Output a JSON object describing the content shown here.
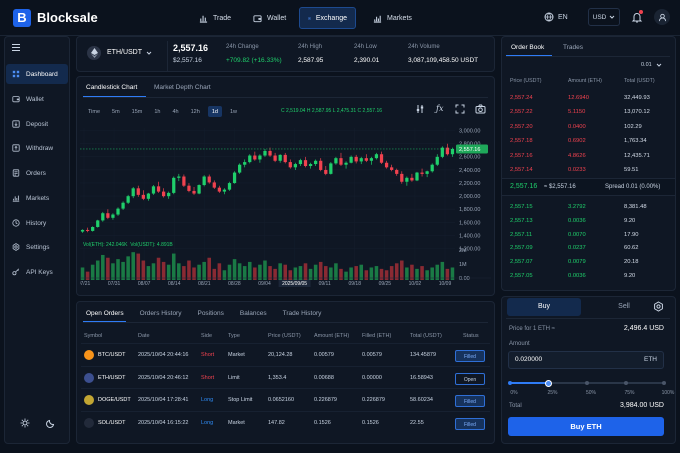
{
  "app": {
    "logo_letter": "B",
    "name": "Blocksale"
  },
  "nav": [
    {
      "label": "Trade",
      "icon": "chart-icon"
    },
    {
      "label": "Wallet",
      "icon": "wallet-icon"
    },
    {
      "label": "Exchange",
      "icon": "exchange-icon"
    },
    {
      "label": "Markets",
      "icon": "markets-icon"
    }
  ],
  "header_right": {
    "language": "EN",
    "currency": "USD"
  },
  "sidebar": {
    "items": [
      {
        "label": "Dashboard",
        "icon": "grid-icon"
      },
      {
        "label": "Wallet",
        "icon": "wallet-icon"
      },
      {
        "label": "Deposit",
        "icon": "deposit-icon"
      },
      {
        "label": "Withdraw",
        "icon": "withdraw-icon"
      },
      {
        "label": "Orders",
        "icon": "orders-icon"
      },
      {
        "label": "Markets",
        "icon": "markets-icon"
      },
      {
        "label": "History",
        "icon": "history-icon"
      },
      {
        "label": "Settings",
        "icon": "gear-icon"
      },
      {
        "label": "API Keys",
        "icon": "key-icon"
      }
    ]
  },
  "ticker": {
    "pair": "ETH/USDT",
    "price": "2,557.16",
    "price_usd": "$2,557.16",
    "change_label": "24h Change",
    "change": "+709.82 (+16.33%)",
    "high_label": "24h High",
    "high": "2,587.95",
    "low_label": "24h Low",
    "low": "2,390.01",
    "vol_label": "24h Volume",
    "volume": "3,087,109,458.50 USDT"
  },
  "chart": {
    "tabs": [
      "Candlestick Chart",
      "Market Depth Chart"
    ],
    "timeframes": [
      "Time",
      "5m",
      "15m",
      "1h",
      "4h",
      "12h",
      "1d",
      "1w"
    ],
    "active_tf": "1d",
    "ohlc": "C 2,519.04 H 2,587.95 L 2,475.31 C 2,557.16",
    "vol": "Vol(ETH): 242.046K",
    "vol2": "Vol(USDT): 4.891B",
    "price_tag": "2,557.16",
    "y_ticks": [
      "3,000.00",
      "2,800.00",
      "2,600.00",
      "2,400.00",
      "2,200.00",
      "2,000.00",
      "1,800.00",
      "1,600.00",
      "1,400.00",
      "1,200.00"
    ],
    "vol_ticks": [
      "2M",
      "1M",
      "0.00"
    ],
    "x_ticks": [
      "07/21",
      "07/31",
      "08/07",
      "08/14",
      "08/21",
      "08/28",
      "09/04",
      "2025/09/05",
      "09/11",
      "09/18",
      "09/25",
      "10/02",
      "10/09"
    ]
  },
  "chart_data": {
    "type": "candlestick",
    "candles": [
      [
        1420,
        1455,
        1400,
        1445
      ],
      [
        1445,
        1480,
        1410,
        1430
      ],
      [
        1430,
        1500,
        1420,
        1490
      ],
      [
        1490,
        1600,
        1480,
        1590
      ],
      [
        1590,
        1720,
        1570,
        1700
      ],
      [
        1700,
        1760,
        1610,
        1630
      ],
      [
        1630,
        1700,
        1600,
        1680
      ],
      [
        1680,
        1790,
        1660,
        1770
      ],
      [
        1770,
        1880,
        1750,
        1860
      ],
      [
        1860,
        1980,
        1840,
        1960
      ],
      [
        1960,
        2100,
        1930,
        2080
      ],
      [
        2080,
        2120,
        1950,
        1980
      ],
      [
        1980,
        2050,
        1900,
        1920
      ],
      [
        1920,
        2010,
        1890,
        2000
      ],
      [
        2000,
        2130,
        1980,
        2110
      ],
      [
        2110,
        2180,
        2010,
        2030
      ],
      [
        2030,
        2080,
        1940,
        1960
      ],
      [
        1960,
        2030,
        1920,
        2010
      ],
      [
        2010,
        2260,
        1990,
        2240
      ],
      [
        2240,
        2300,
        2190,
        2260
      ],
      [
        2260,
        2290,
        2100,
        2120
      ],
      [
        2120,
        2160,
        2020,
        2040
      ],
      [
        2040,
        2100,
        1980,
        2000
      ],
      [
        2000,
        2140,
        1990,
        2130
      ],
      [
        2130,
        2280,
        2110,
        2260
      ],
      [
        2260,
        2290,
        2150,
        2170
      ],
      [
        2170,
        2200,
        2070,
        2090
      ],
      [
        2090,
        2120,
        2010,
        2030
      ],
      [
        2030,
        2080,
        1990,
        2060
      ],
      [
        2060,
        2180,
        2040,
        2160
      ],
      [
        2160,
        2340,
        2150,
        2320
      ],
      [
        2320,
        2460,
        2300,
        2440
      ],
      [
        2440,
        2520,
        2400,
        2480
      ],
      [
        2480,
        2600,
        2460,
        2580
      ],
      [
        2580,
        2640,
        2500,
        2520
      ],
      [
        2520,
        2600,
        2470,
        2580
      ],
      [
        2580,
        2680,
        2560,
        2650
      ],
      [
        2650,
        2700,
        2560,
        2580
      ],
      [
        2580,
        2620,
        2480,
        2500
      ],
      [
        2500,
        2600,
        2470,
        2590
      ],
      [
        2590,
        2620,
        2460,
        2480
      ],
      [
        2480,
        2520,
        2380,
        2400
      ],
      [
        2400,
        2470,
        2360,
        2450
      ],
      [
        2450,
        2530,
        2420,
        2510
      ],
      [
        2510,
        2560,
        2400,
        2420
      ],
      [
        2420,
        2470,
        2380,
        2450
      ],
      [
        2450,
        2520,
        2420,
        2500
      ],
      [
        2500,
        2540,
        2340,
        2360
      ],
      [
        2360,
        2420,
        2280,
        2300
      ],
      [
        2300,
        2480,
        2290,
        2460
      ],
      [
        2460,
        2560,
        2440,
        2540
      ],
      [
        2540,
        2620,
        2420,
        2440
      ],
      [
        2440,
        2490,
        2380,
        2470
      ],
      [
        2470,
        2580,
        2460,
        2560
      ],
      [
        2560,
        2590,
        2460,
        2490
      ],
      [
        2490,
        2560,
        2450,
        2540
      ],
      [
        2540,
        2600,
        2480,
        2500
      ],
      [
        2500,
        2560,
        2440,
        2540
      ],
      [
        2540,
        2620,
        2520,
        2600
      ],
      [
        2600,
        2640,
        2450,
        2470
      ],
      [
        2470,
        2500,
        2380,
        2400
      ],
      [
        2400,
        2440,
        2340,
        2360
      ],
      [
        2360,
        2380,
        2270,
        2300
      ],
      [
        2300,
        2340,
        2150,
        2180
      ],
      [
        2180,
        2260,
        2120,
        2240
      ],
      [
        2240,
        2300,
        2180,
        2200
      ],
      [
        2200,
        2330,
        2190,
        2320
      ],
      [
        2320,
        2380,
        2260,
        2300
      ],
      [
        2300,
        2350,
        2250,
        2340
      ],
      [
        2340,
        2460,
        2320,
        2440
      ],
      [
        2440,
        2600,
        2420,
        2560
      ],
      [
        2560,
        2720,
        2540,
        2700
      ],
      [
        2700,
        2760,
        2580,
        2600
      ],
      [
        2600,
        2700,
        2560,
        2680
      ]
    ],
    "volume": [
      0.9,
      0.6,
      1.1,
      1.4,
      1.8,
      1.6,
      1.2,
      1.5,
      1.3,
      1.7,
      2.0,
      1.9,
      1.4,
      1.0,
      1.2,
      1.6,
      1.3,
      1.1,
      1.9,
      1.2,
      1.0,
      1.4,
      0.9,
      1.1,
      1.3,
      1.6,
      0.8,
      1.2,
      0.7,
      1.1,
      1.5,
      1.2,
      1.0,
      1.3,
      0.9,
      1.1,
      1.4,
      1.0,
      0.8,
      1.2,
      1.1,
      0.7,
      0.9,
      1.0,
      1.2,
      0.8,
      1.1,
      1.3,
      1.0,
      0.9,
      1.2,
      0.8,
      0.6,
      0.9,
      1.0,
      1.1,
      0.7,
      0.9,
      1.0,
      0.8,
      0.7,
      1.0,
      1.2,
      1.4,
      0.9,
      1.1,
      0.8,
      1.0,
      0.7,
      0.9,
      1.1,
      1.3,
      0.8,
      0.9
    ],
    "ylim": [
      1200,
      3000
    ],
    "vol_max": 2.3
  },
  "orderbook": {
    "tabs": [
      "Order Book",
      "Trades"
    ],
    "precision": "0.01",
    "headers": [
      "Price (USDT)",
      "Amount (ETH)",
      "Total (USDT)"
    ],
    "asks": [
      [
        "2,557.24",
        "12.6940",
        "32,449.93"
      ],
      [
        "2,557.22",
        "5.1150",
        "13,070.12"
      ],
      [
        "2,557.20",
        "0.0400",
        "102.29"
      ],
      [
        "2,557.18",
        "0.6902",
        "1,763.34"
      ],
      [
        "2,557.16",
        "4.8626",
        "12,435.71"
      ],
      [
        "2,557.14",
        "0.0233",
        "59.51"
      ]
    ],
    "mid_price": "2,557.16",
    "mid_usd": "≈ $2,557.16",
    "spread": "Spread 0.01 (0.00%)",
    "bids": [
      [
        "2,557.15",
        "3.2792",
        "8,381.48"
      ],
      [
        "2,557.13",
        "0.0036",
        "9.20"
      ],
      [
        "2,557.11",
        "0.0070",
        "17.90"
      ],
      [
        "2,557.09",
        "0.0237",
        "60.62"
      ],
      [
        "2,557.07",
        "0.0079",
        "20.18"
      ],
      [
        "2,557.05",
        "0.0036",
        "9.20"
      ]
    ]
  },
  "trade_form": {
    "tabs": [
      "Buy",
      "Sell"
    ],
    "price_label": "Price for 1 ETH ≈",
    "price": "2,496.4 USD",
    "amount_label": "Amount",
    "amount": "0.020000",
    "amount_unit": "ETH",
    "slider_pct": 0.25,
    "slider_ticks": [
      "0%",
      "25%",
      "50%",
      "75%",
      "100%"
    ],
    "total_label": "Total",
    "total": "3,984.00 USD",
    "buy_button": "Buy ETH"
  },
  "orders": {
    "tabs": [
      "Open Orders",
      "Orders History",
      "Positions",
      "Balances",
      "Trade History"
    ],
    "headers": [
      "Symbol",
      "Date",
      "Side",
      "Type",
      "Price (USDT)",
      "Amount (ETH)",
      "Filled (ETH)",
      "Total (USDT)",
      "Status"
    ],
    "rows": [
      {
        "coin": "BTC",
        "color": "#f7931a",
        "symbol": "BTC/USDT",
        "date": "2025/10/04 20:44:16",
        "side": "Short",
        "type": "Market",
        "price": "20,124.28",
        "amount": "0.00579",
        "filled": "0.00579",
        "total": "134.45879",
        "status": "Filled"
      },
      {
        "coin": "ETH",
        "color": "#3c4f8f",
        "symbol": "ETH/USDT",
        "date": "2025/10/04 20:46:12",
        "side": "Short",
        "type": "Limit",
        "price": "1,353.4",
        "amount": "0.00688",
        "filled": "0.00000",
        "total": "16.58943",
        "status": "Open"
      },
      {
        "coin": "DOGE",
        "color": "#c2a633",
        "symbol": "DOGE/USDT",
        "date": "2025/10/04 17:28:41",
        "side": "Long",
        "type": "Stop Limit",
        "price": "0.0652160",
        "amount": "0.226879",
        "filled": "0.226879",
        "total": "58.60234",
        "status": "Filled"
      },
      {
        "coin": "SOL",
        "color": "#222a3a",
        "symbol": "SOL/USDT",
        "date": "2025/10/04 16:15:22",
        "side": "Long",
        "type": "Market",
        "price": "147.82",
        "amount": "0.1526",
        "filled": "0.1526",
        "total": "22.55",
        "status": "Filled"
      }
    ]
  }
}
